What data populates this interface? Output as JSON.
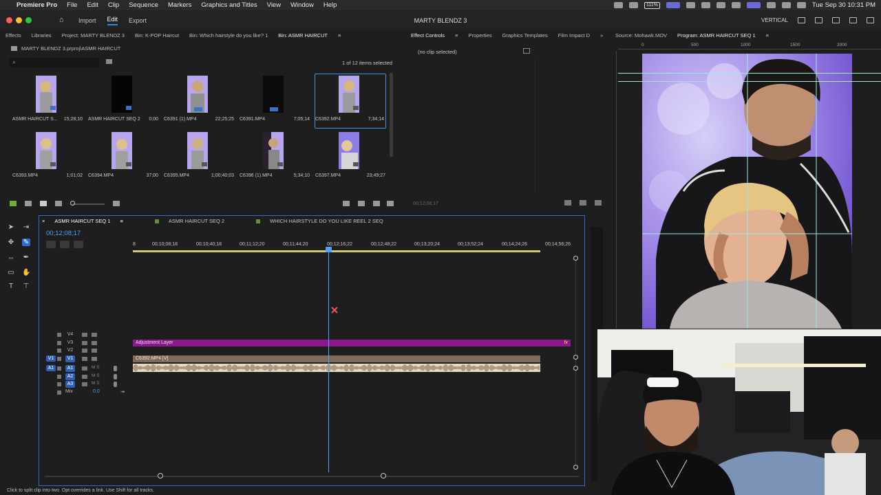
{
  "menubar": {
    "app_name": "Premiere Pro",
    "items": [
      "File",
      "Edit",
      "Clip",
      "Sequence",
      "Markers",
      "Graphics and Titles",
      "View",
      "Window",
      "Help"
    ],
    "battery": "111%",
    "datetime": "Tue Sep 30  10:31 PM"
  },
  "header": {
    "tabs": [
      "Import",
      "Edit",
      "Export"
    ],
    "active_tab": "Edit",
    "project_title": "MARTY BLENDZ 3",
    "workspace": "VERTICAL"
  },
  "bin_panel": {
    "tabs": [
      "Effects",
      "Libraries",
      "Project: MARTY BLENDZ 3",
      "Bin: K-POP Haircut",
      "Bin: Which hairstyle do you like? 1",
      "Bin: ASMR HAIRCUT"
    ],
    "active_tab": "Bin: ASMR HAIRCUT",
    "path": "MARTY BLENDZ 3.prproj\\ASMR HAIRCUT",
    "search_placeholder": "",
    "selection_count": "1 of 12 items selected",
    "items": [
      {
        "name": "ASMR HAIRCUT S...",
        "duration": "15;28;10"
      },
      {
        "name": "ASMR HAIRCUT SEQ 2",
        "duration": "0;00"
      },
      {
        "name": "C6391 (1).MP4",
        "duration": "22;25;25"
      },
      {
        "name": "C6391.MP4",
        "duration": "7;05;14"
      },
      {
        "name": "C6392.MP4",
        "duration": "7;34;14"
      },
      {
        "name": "C6393.MP4",
        "duration": "1;01;02"
      },
      {
        "name": "C6394.MP4",
        "duration": "37;00"
      },
      {
        "name": "C6395.MP4",
        "duration": "1;00;40;03"
      },
      {
        "name": "C6396 (1).MP4",
        "duration": "5;34;10"
      },
      {
        "name": "C6397.MP4",
        "duration": "23;49;27"
      }
    ]
  },
  "effect_controls": {
    "tabs": [
      "Effect Controls",
      "Properties",
      "Graphics Templates",
      "Film Impact D"
    ],
    "active_tab": "Effect Controls",
    "no_clip": "(no clip selected)",
    "timecode": "00;12;08;17"
  },
  "program_monitor": {
    "tabs": [
      "Source: Mohawk.MOV",
      "Program: ASMR HAIRCUT SEQ 1"
    ],
    "active_tab": "Program: ASMR HAIRCUT SEQ 1",
    "ruler_labels": [
      "0",
      "500",
      "1000",
      "1500",
      "2000"
    ]
  },
  "timeline": {
    "tabs": [
      "ASMR HAIRCUT SEQ 1",
      "ASMR HAIRCUT SEQ 2",
      "WHICH HAIRSTYLE DO YOU LIKE REEL 2 SEQ"
    ],
    "active_tab": "ASMR HAIRCUT SEQ 1",
    "timecode": "00;12;08;17",
    "ruler": [
      "8",
      "00;10;08;18",
      "00;10;40;18",
      "00;11;12;20",
      "00;11;44;20",
      "00;12;16;22",
      "00;12;48;22",
      "00;13;20;24",
      "00;13;52;24",
      "00;14;24;26",
      "00;14;56;26"
    ],
    "video_tracks": [
      "V4",
      "V3",
      "V2",
      "V1"
    ],
    "audio_tracks": [
      "A1",
      "A2",
      "A3"
    ],
    "src_v": "V1",
    "src_a": "A1",
    "mix_label": "Mix",
    "mix_value": "0.0",
    "clips": {
      "adjustment": "Adjustment Layer",
      "adjustment_fx": "fx",
      "video": "C6392.MP4 [V]"
    }
  },
  "status": "Click to split clip into two. Opt overrides a link. Use Shift for all tracks."
}
